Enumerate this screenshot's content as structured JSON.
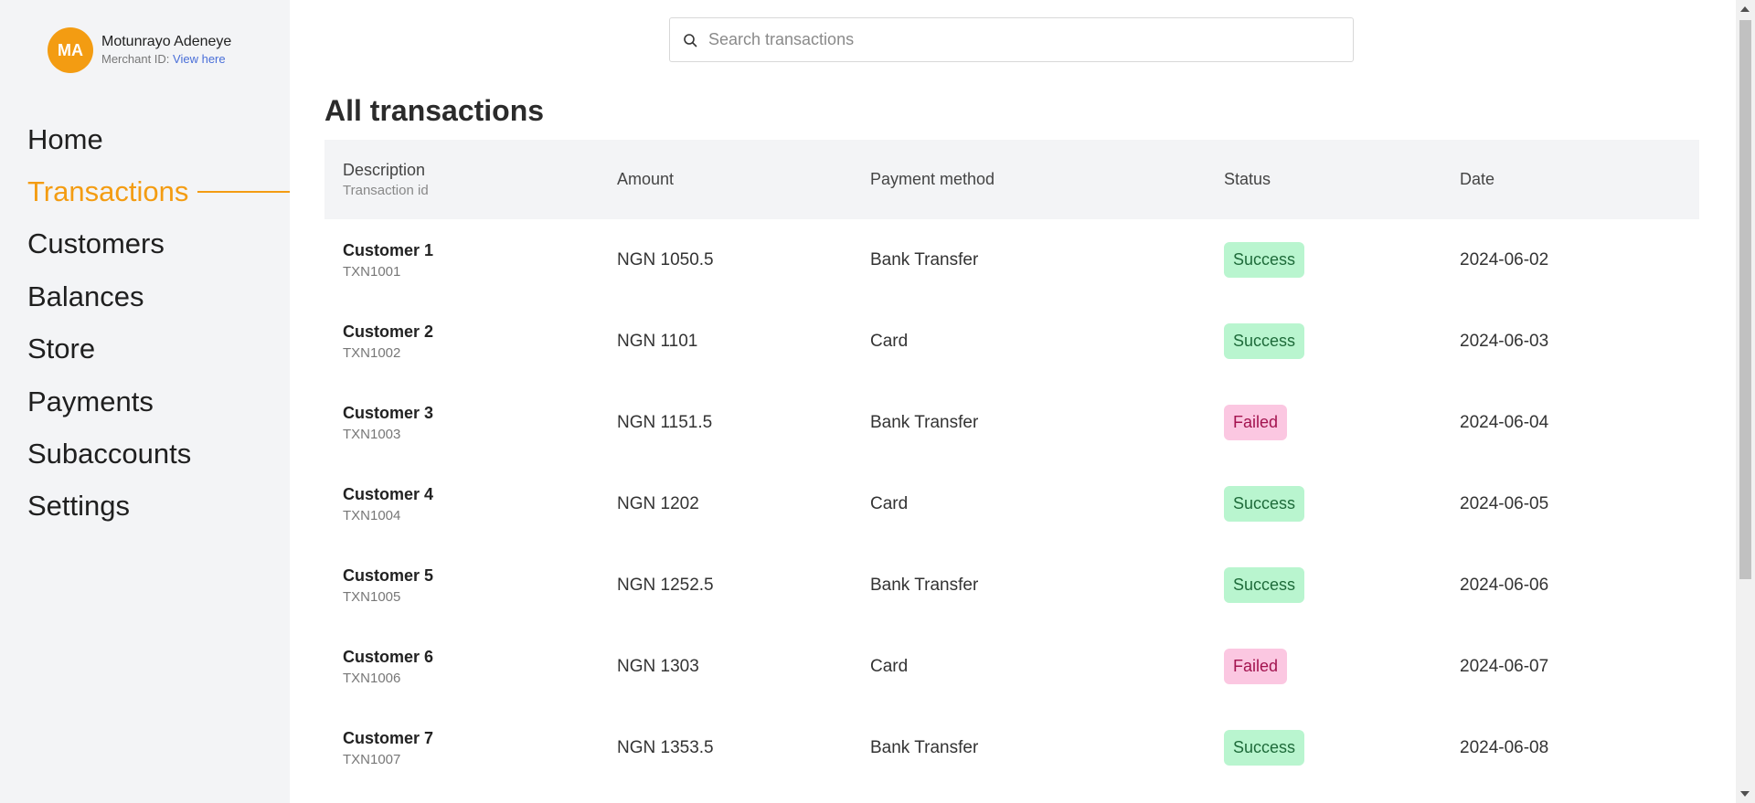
{
  "profile": {
    "initials": "MA",
    "name": "Motunrayo Adeneye",
    "merchant_label": "Merchant ID: ",
    "merchant_link": "View here"
  },
  "nav": {
    "items": [
      {
        "label": "Home"
      },
      {
        "label": "Transactions"
      },
      {
        "label": "Customers"
      },
      {
        "label": "Balances"
      },
      {
        "label": "Store"
      },
      {
        "label": "Payments"
      },
      {
        "label": "Subaccounts"
      },
      {
        "label": "Settings"
      }
    ],
    "active": "Transactions"
  },
  "search": {
    "placeholder": "Search transactions",
    "icon": "search-icon"
  },
  "page": {
    "title": "All transactions"
  },
  "table": {
    "headers": {
      "description": "Description",
      "transaction_id": "Transaction id",
      "amount": "Amount",
      "payment_method": "Payment method",
      "status": "Status",
      "date": "Date"
    },
    "rows": [
      {
        "customer": "Customer 1",
        "txn": "TXN1001",
        "amount": "NGN 1050.5",
        "method": "Bank Transfer",
        "status": "Success",
        "date": "2024-06-02"
      },
      {
        "customer": "Customer 2",
        "txn": "TXN1002",
        "amount": "NGN 1101",
        "method": "Card",
        "status": "Success",
        "date": "2024-06-03"
      },
      {
        "customer": "Customer 3",
        "txn": "TXN1003",
        "amount": "NGN 1151.5",
        "method": "Bank Transfer",
        "status": "Failed",
        "date": "2024-06-04"
      },
      {
        "customer": "Customer 4",
        "txn": "TXN1004",
        "amount": "NGN 1202",
        "method": "Card",
        "status": "Success",
        "date": "2024-06-05"
      },
      {
        "customer": "Customer 5",
        "txn": "TXN1005",
        "amount": "NGN 1252.5",
        "method": "Bank Transfer",
        "status": "Success",
        "date": "2024-06-06"
      },
      {
        "customer": "Customer 6",
        "txn": "TXN1006",
        "amount": "NGN 1303",
        "method": "Card",
        "status": "Failed",
        "date": "2024-06-07"
      },
      {
        "customer": "Customer 7",
        "txn": "TXN1007",
        "amount": "NGN 1353.5",
        "method": "Bank Transfer",
        "status": "Success",
        "date": "2024-06-08"
      }
    ]
  },
  "colors": {
    "accent": "#f39c12",
    "sidebar_bg": "#f3f4f6",
    "success_bg": "#b9f5cf",
    "failed_bg": "#fbc7e1",
    "link": "#4a6fd8"
  }
}
